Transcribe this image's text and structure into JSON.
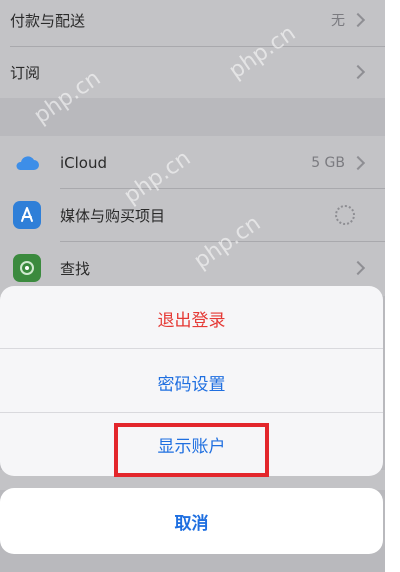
{
  "settings": {
    "payment_label": "付款与配送",
    "payment_value": "无",
    "subscriptions_label": "订阅",
    "icloud_label": "iCloud",
    "icloud_value": "5 GB",
    "media_label": "媒体与购买项目",
    "find_label": "查找"
  },
  "action_sheet": {
    "sign_out": "退出登录",
    "password_settings": "密码设置",
    "show_account": "显示账户",
    "cancel": "取消"
  },
  "watermark": "php.cn",
  "colors": {
    "destructive": "#e53935",
    "action_blue": "#1f6fe0",
    "highlight_border": "#e3262b"
  }
}
